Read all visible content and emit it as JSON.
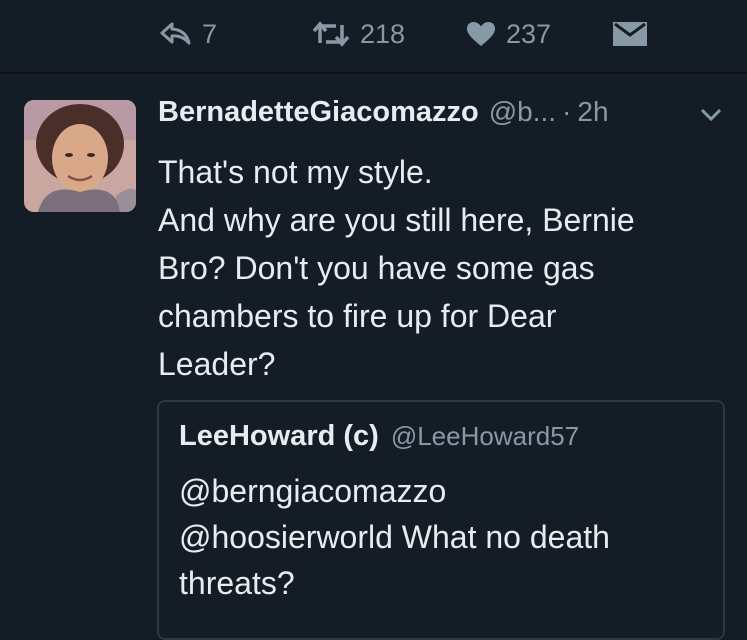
{
  "actions": {
    "reply_count": "7",
    "retweet_count": "218",
    "like_count": "237"
  },
  "tweet": {
    "display_name": "BernadetteGiacomazzo",
    "handle": "@b...",
    "separator": "·",
    "time": "2h",
    "text_lines": [
      "That's not my style.",
      "And why are you still here, Bernie",
      "Bro? Don't you have some gas",
      "chambers to fire up for Dear",
      "Leader?"
    ]
  },
  "quoted_tweet": {
    "display_name": "LeeHoward (c)",
    "handle": "@LeeHoward57",
    "text_lines": [
      "@berngiacomazzo",
      "@hoosierworld What no death",
      "threats?"
    ]
  },
  "colors": {
    "background": "#141d26",
    "text": "#e7ecf0",
    "muted": "#8899a6",
    "border": "#2a3744"
  }
}
